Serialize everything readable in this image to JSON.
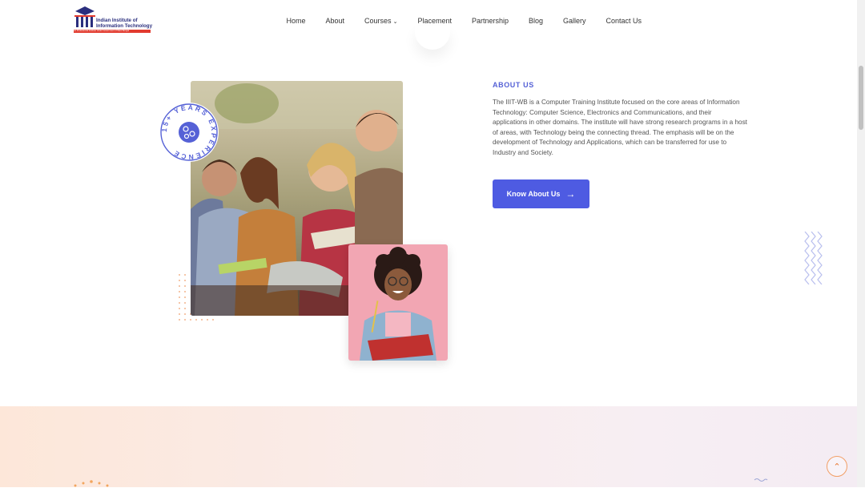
{
  "logo": {
    "line1": "Indian Institute of",
    "line2": "Information Technology",
    "tagline": "An Professional Institute Under Government of West Bengal"
  },
  "nav": {
    "items": [
      {
        "label": "Home"
      },
      {
        "label": "About"
      },
      {
        "label": "Courses"
      },
      {
        "label": "Placement"
      },
      {
        "label": "Partnership"
      },
      {
        "label": "Blog"
      },
      {
        "label": "Gallery"
      },
      {
        "label": "Contact Us"
      }
    ]
  },
  "badge": {
    "text": "15+ YEARS EXPERIENCE"
  },
  "about": {
    "label": "ABOUT US",
    "description": "The IIIT-WB is a Computer Training Institute focused on the core areas of Information Technology: Computer Science, Electronics and Communications, and their applications in other domains. The institute will have strong research programs in a host of areas, with Technology being the connecting thread. The emphasis will be on the development of Technology and Applications, which can be transferred for use to Industry and Society.",
    "cta_label": "Know About Us"
  },
  "colors": {
    "accent": "#4e5be2",
    "label": "#5561d6",
    "band_start": "#fde7d9",
    "band_end": "#f4ecf3",
    "scroll_top": "#e8762f"
  },
  "icons": {
    "cta": "arrow-right-icon",
    "courses_dropdown": "chevron-down-icon",
    "badge": "students-icon",
    "scroll_top": "chevron-up-icon"
  }
}
